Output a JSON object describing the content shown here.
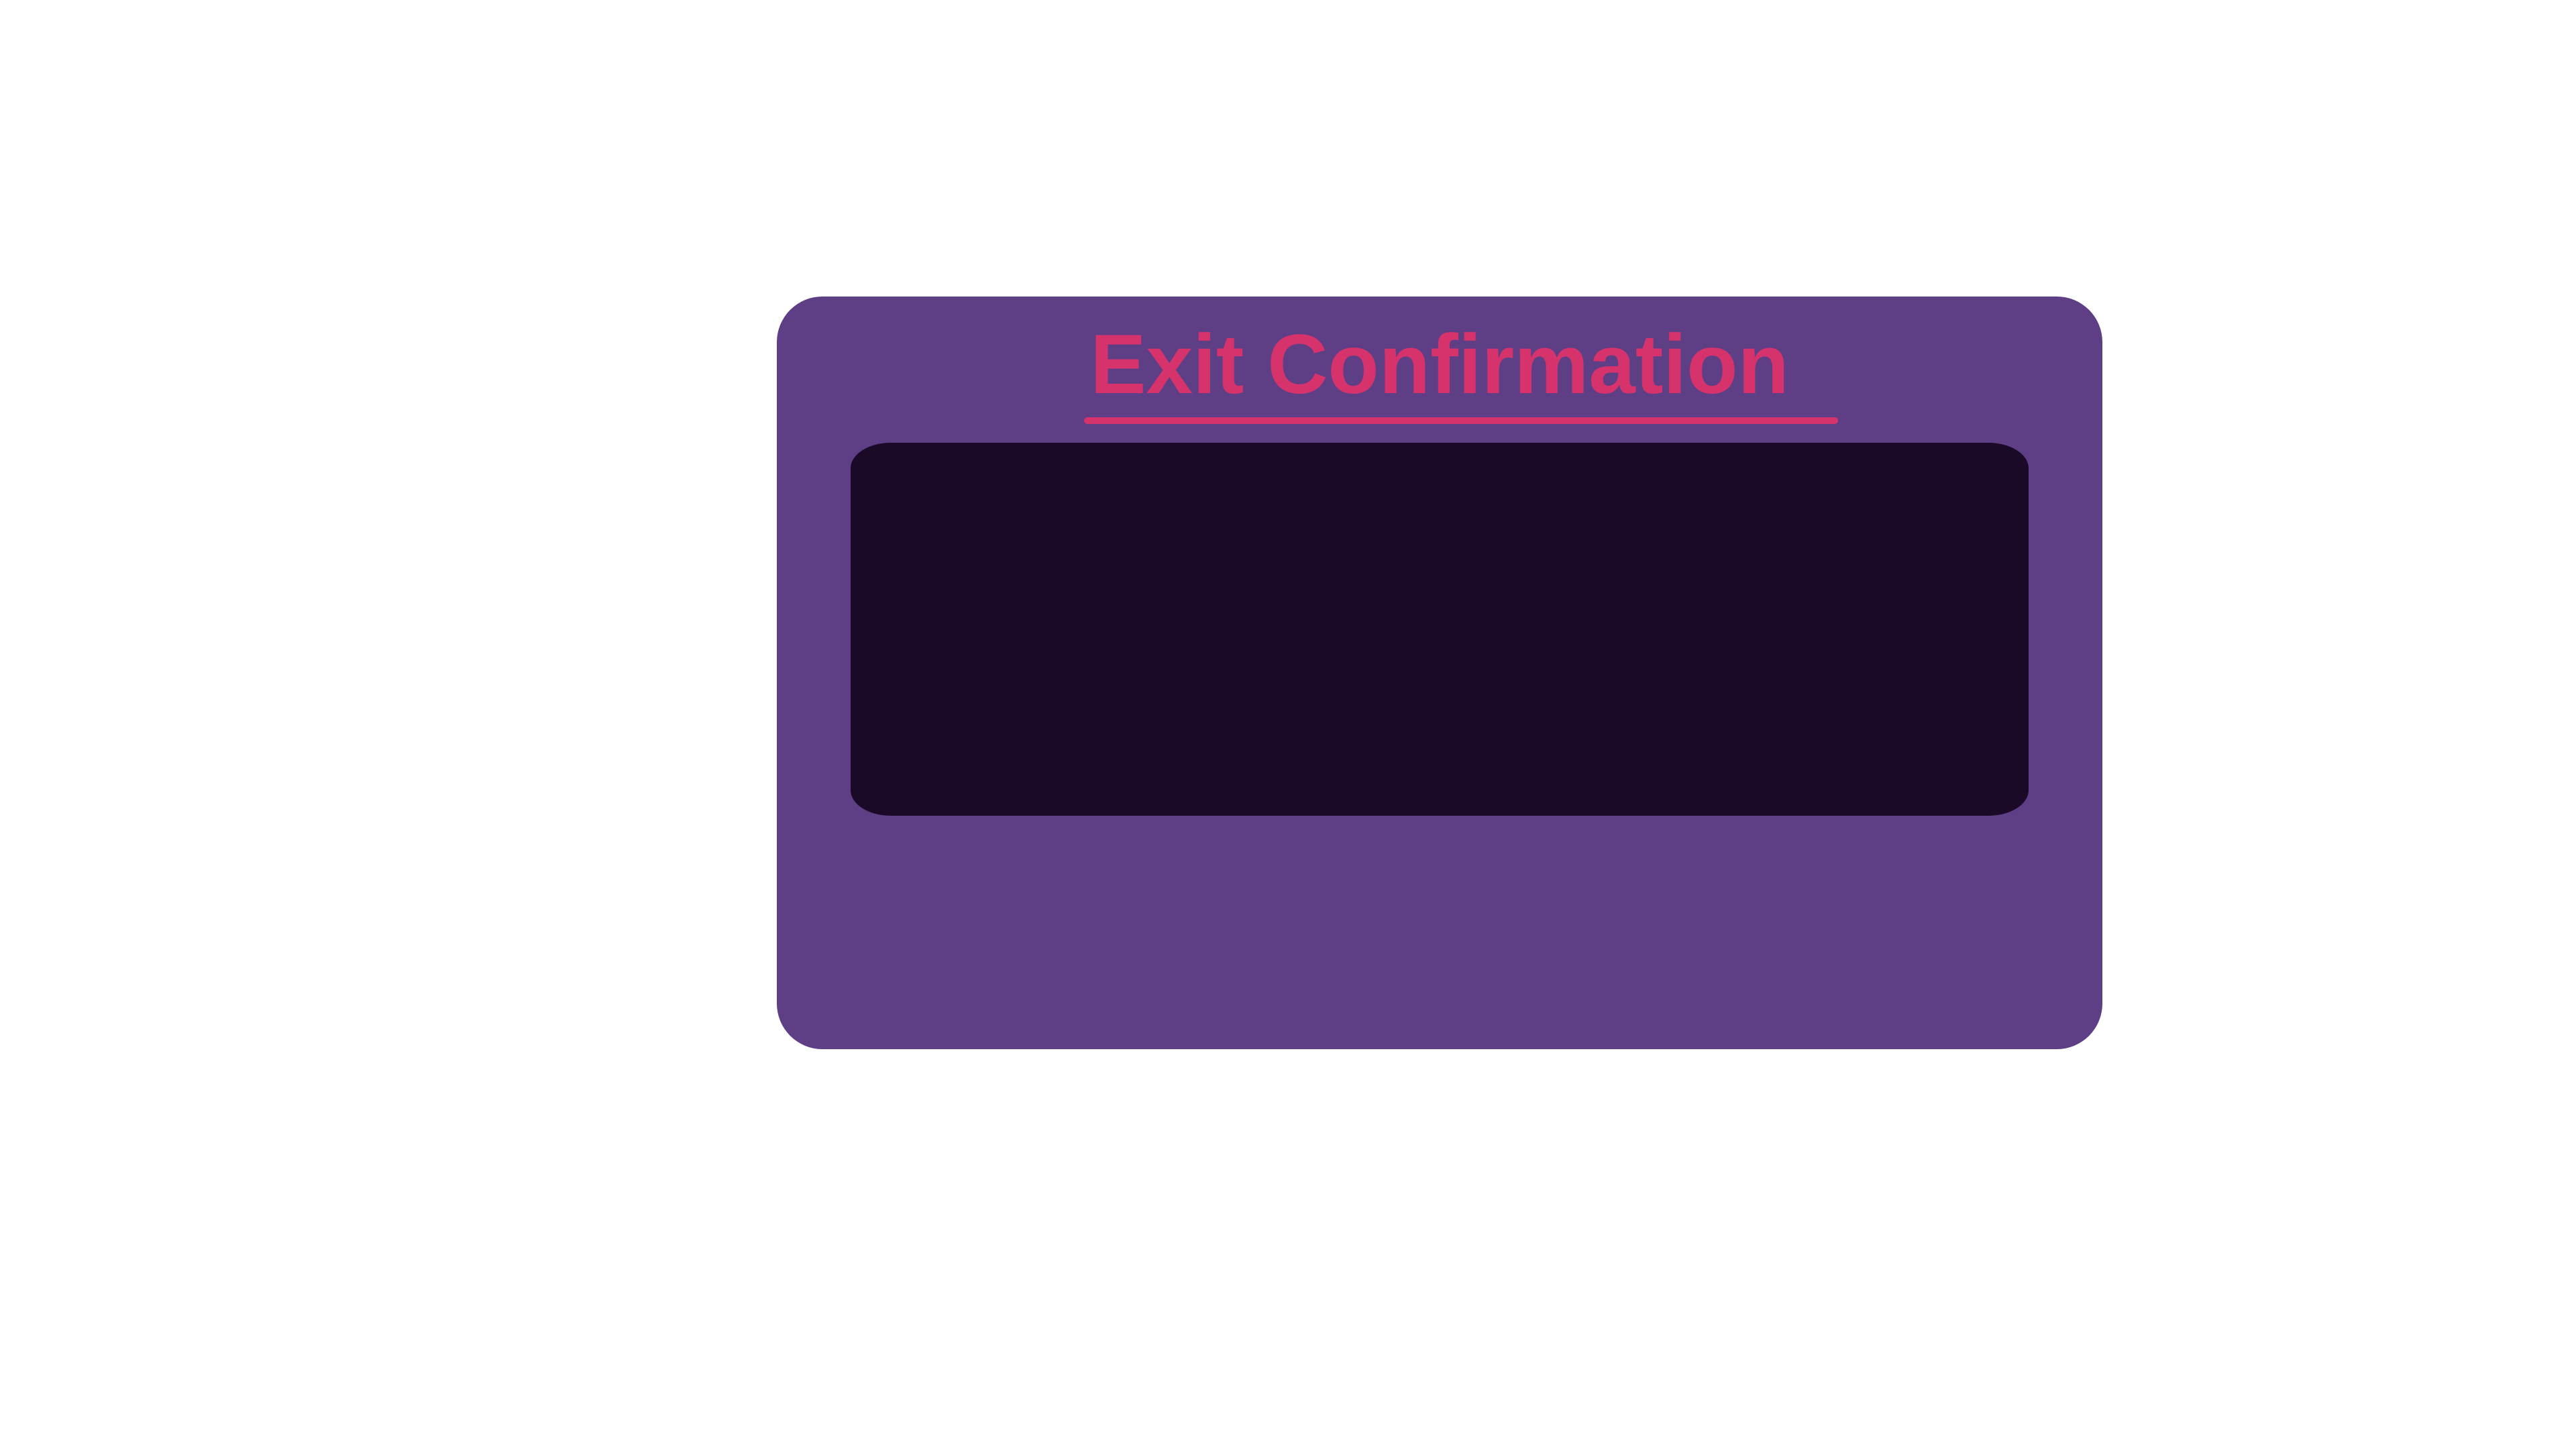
{
  "dialog": {
    "title": "Exit Confirmation",
    "message": ""
  },
  "colors": {
    "background": "#ffffff",
    "dialog": "#5e3f86",
    "title_accent": "#d6336c",
    "panel": "#1b0a27"
  }
}
